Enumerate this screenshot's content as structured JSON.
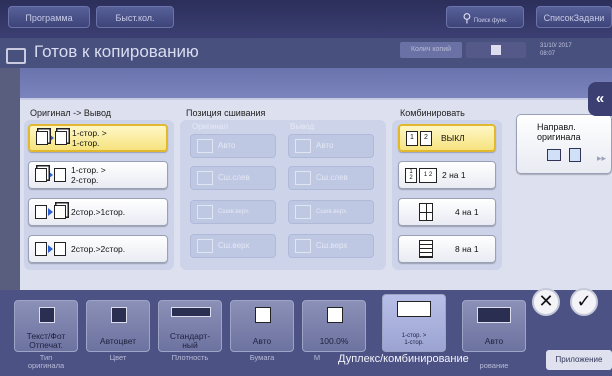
{
  "topbar": {
    "program_label": "Программа",
    "quick_label": "Быст.кол.",
    "search_label": "Поиск функ.",
    "scan_copy_label": "СписокЗадани"
  },
  "title_row": {
    "title": "Готов к копированию",
    "copies_label": "Колич копий",
    "date": "31/10/ 2017",
    "time": "08:07"
  },
  "dialog": {
    "original_output": {
      "label": "Оригинал -> Вывод",
      "options": [
        {
          "label": "1-стор. >\n1-стор.",
          "selected": true
        },
        {
          "label": "1-стор. >\n2-стор.",
          "selected": false
        },
        {
          "label": "2стор.>1стор.",
          "selected": false
        },
        {
          "label": "2стор.>2стор.",
          "selected": false
        }
      ]
    },
    "binding": {
      "label": "Позиция сшивания",
      "original_label": "Оригинал",
      "output_label": "Вывод",
      "original_options": [
        "Авто",
        "Сш.слев",
        "Сшив.верх.",
        "Сш.верх"
      ],
      "output_options": [
        "Авто",
        "Сш.слев",
        "Сшив.верх.",
        "Сш.верх"
      ]
    },
    "combine": {
      "label": "Комбинировать",
      "options": [
        {
          "label": "ВЫКЛ",
          "selected": true
        },
        {
          "label": "2 на 1",
          "selected": false
        },
        {
          "label": "4 на 1",
          "selected": false
        },
        {
          "label": "8 на 1",
          "selected": false
        }
      ]
    },
    "direction": {
      "label": "Направл. оригинала"
    }
  },
  "bottom": {
    "tiles": [
      {
        "label": "Текст/Фот\nОтпечат.",
        "category": "Тип\nоригинала"
      },
      {
        "label": "Автоцвет",
        "category": "Цвет"
      },
      {
        "label": "Стандарт-\nный",
        "category": "Плотность"
      },
      {
        "label": "Авто",
        "category": "Бумага"
      },
      {
        "label": "100.0%",
        "category": "М"
      },
      {
        "label": "1-стор. >\n1-стор.",
        "category": ""
      },
      {
        "label": "Авто",
        "category": "рование"
      }
    ],
    "status_text": "Дуплекс/комбинирование",
    "apps_label": "Приложение",
    "cancel_symbol": "✕",
    "ok_symbol": "✓"
  }
}
